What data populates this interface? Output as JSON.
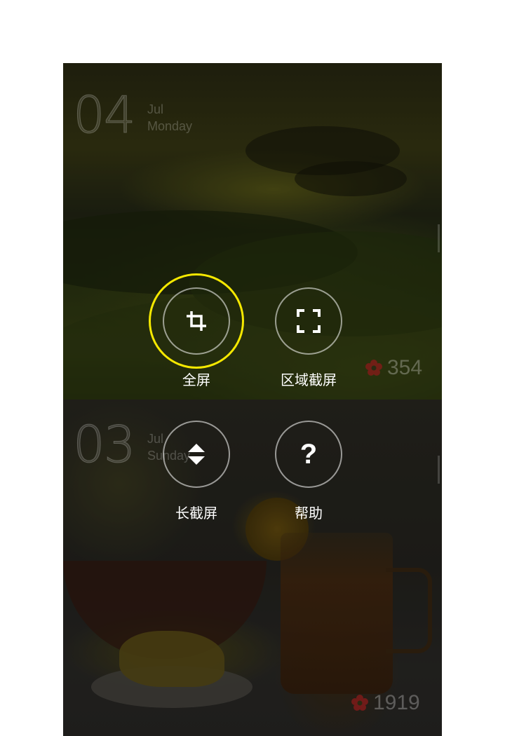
{
  "cards": [
    {
      "day": "04",
      "month": "Jul",
      "weekday": "Monday",
      "likes": "354"
    },
    {
      "day": "03",
      "month": "Jul",
      "weekday": "Sunday",
      "likes": "1919"
    }
  ],
  "screenshot_menu": {
    "items": [
      {
        "label": "全屏",
        "icon": "crop-icon",
        "highlighted": true
      },
      {
        "label": "区域截屏",
        "icon": "fullscreen-corners-icon",
        "highlighted": false
      },
      {
        "label": "长截屏",
        "icon": "scroll-arrows-icon",
        "highlighted": false
      },
      {
        "label": "帮助",
        "icon": "question-icon",
        "help_symbol": "?",
        "highlighted": false
      }
    ]
  },
  "colors": {
    "highlight_ring": "#f5e800",
    "like_icon": "#8a1a1a",
    "button_border": "rgba(255,255,255,0.55)"
  }
}
